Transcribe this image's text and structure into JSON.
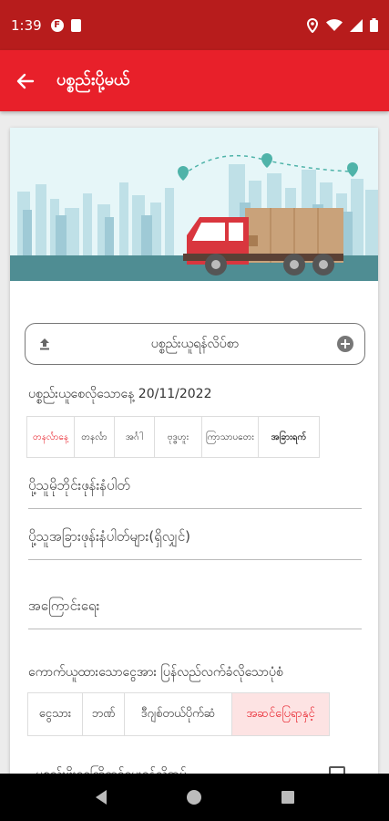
{
  "status_bar": {
    "time": "1:39",
    "icons": [
      "notification-f-icon",
      "sim-card-icon",
      "location-icon",
      "wifi-icon",
      "signal-icon",
      "battery-icon"
    ]
  },
  "app_bar": {
    "back_icon": "arrow-left-icon",
    "title": "ပစ္စည်းပို့မယ်"
  },
  "form": {
    "upload": {
      "label": "ပစ္စည်းယူရန်လိပ်စာ",
      "left_icon": "upload-icon",
      "right_icon": "location-pin-icon"
    },
    "pickup_date_label": "ပစ္စည်းယူစေလိုသောနေ့ 20/11/2022",
    "time_tabs": [
      {
        "label": "တနင်္လာနေ့",
        "active": true
      },
      {
        "label": "တနင်္လာ",
        "active": false
      },
      {
        "label": "အင်္ဂါ",
        "active": false
      },
      {
        "label": "ဗုဒ္ဓဟူး",
        "active": false
      },
      {
        "label": "ကြာသာပတေး",
        "active": false
      },
      {
        "label": "အခြားရက်",
        "active": false
      }
    ],
    "receiver_phone_placeholder": "ပို့သူမိုဘိုင်းဖုန်းနံပါတ်",
    "other_phone_placeholder": "ပို့သူအခြားဖုန်းနံပါတ်များ(ရှိလျှင်)",
    "address_placeholder": "အကြောင်းရေး",
    "payment_label": "ကောက်ယူထားသောငွေအား ပြန်လည်လက်ခံလိုသောပုံစံ",
    "payment_tabs": [
      {
        "label": "ငွေသား",
        "active": false
      },
      {
        "label": "ဘဏ်",
        "active": false
      },
      {
        "label": "ဒီဂျစ်တယ်ပိုက်ဆံ",
        "active": false
      },
      {
        "label": "အဆင်ပြေရာနှင့်",
        "active": true
      }
    ],
    "checkbox_label": "ပစ္စည်းဖိုးငွေကြိုတင်ပေးရန်လိုအပ်"
  },
  "colors": {
    "status_bar": "#b71c1c",
    "app_bar": "#e8202a",
    "accent": "#e8202a",
    "active_tab_bg": "#fde3e3",
    "banner_bg": "#e6f6f8",
    "truck_red": "#d9363e",
    "cargo_box": "#c9a27a"
  },
  "nav_bar": {
    "icons": [
      "back-triangle-icon",
      "home-circle-icon",
      "recents-square-icon"
    ]
  }
}
